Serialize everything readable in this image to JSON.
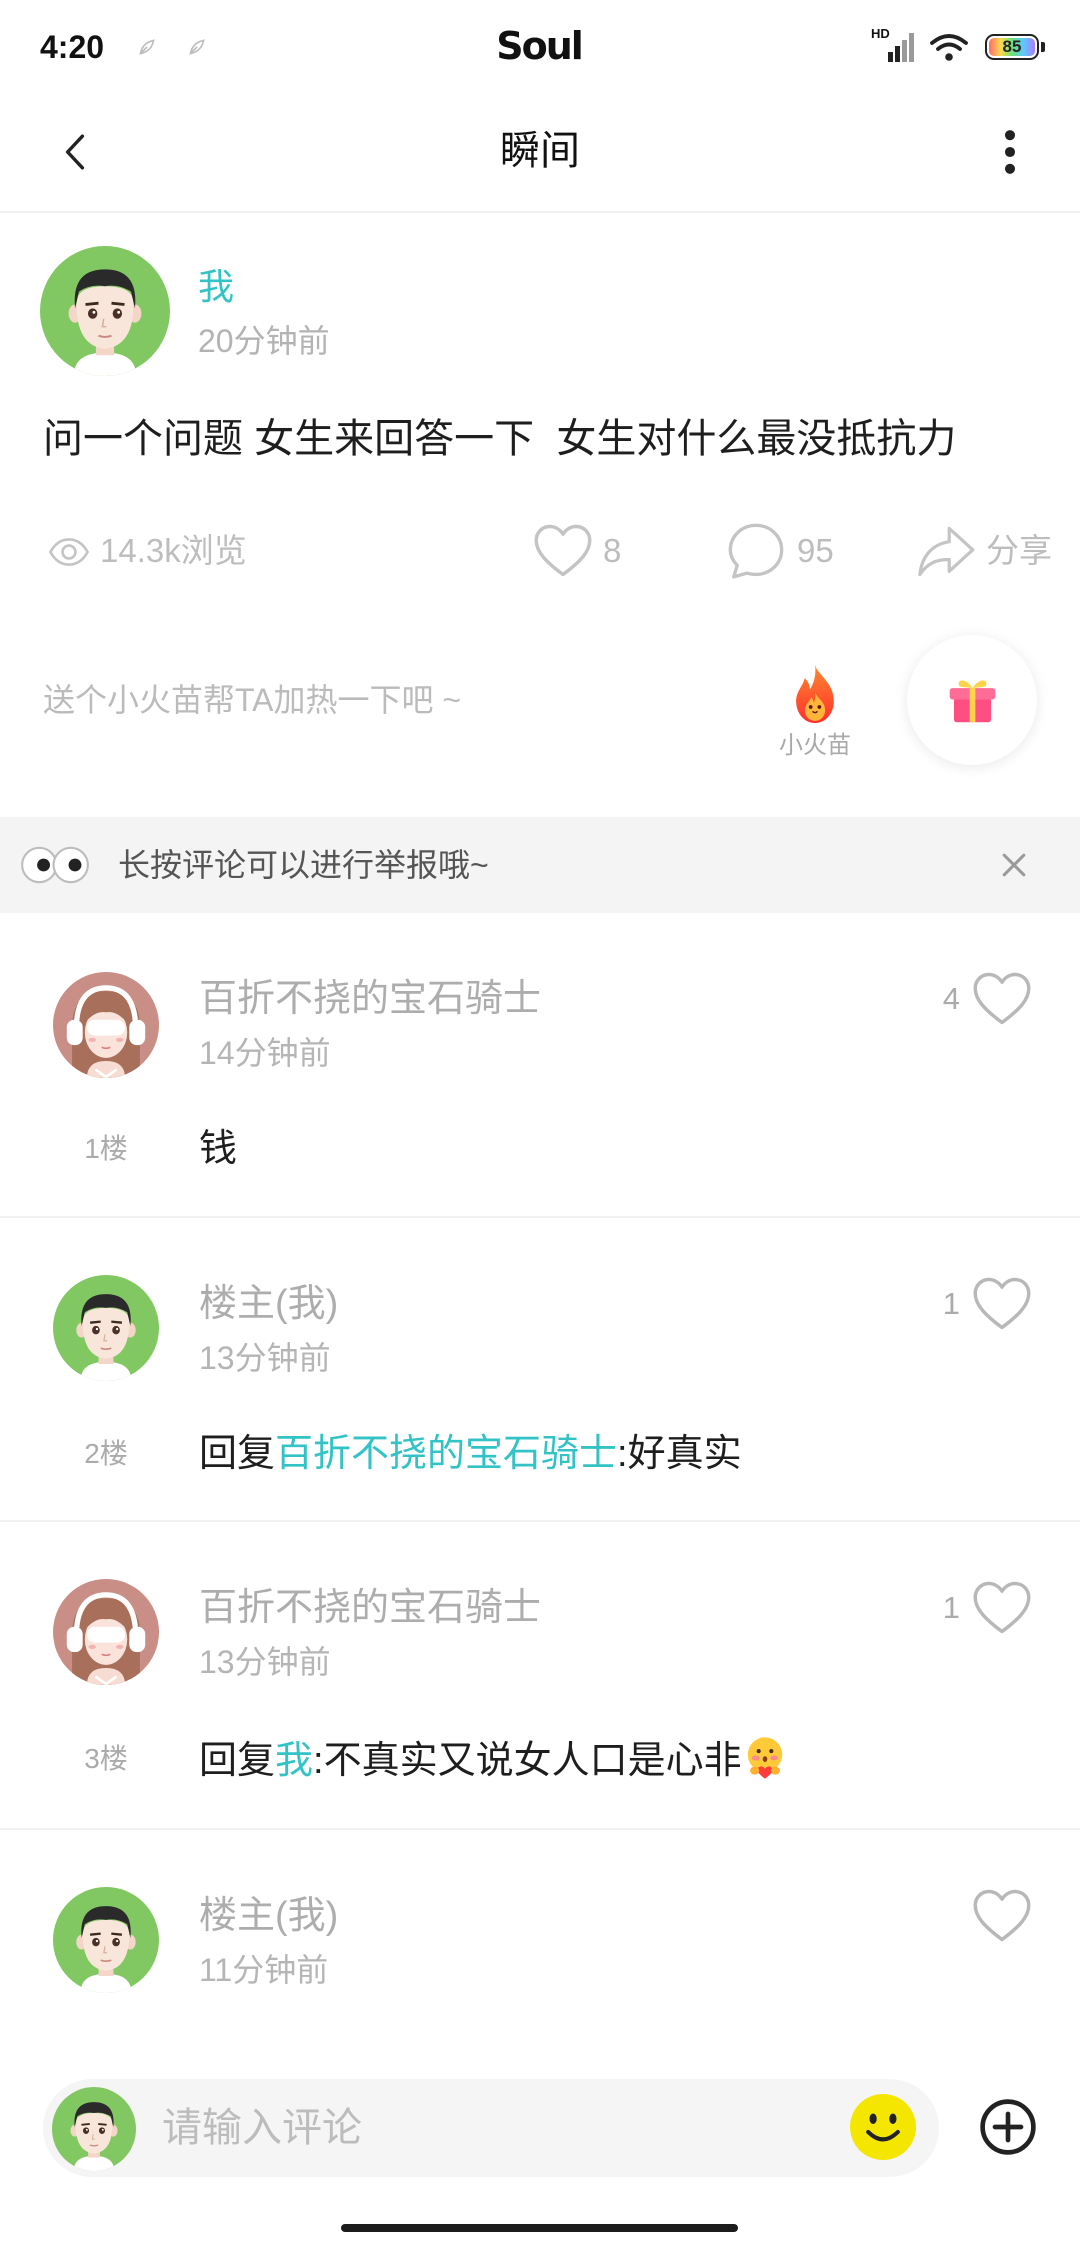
{
  "status_bar": {
    "time": "4:20",
    "app_name": "Soul",
    "network_label": "HD",
    "battery": "85"
  },
  "header": {
    "title": "瞬间",
    "back_icon": "chevron-left-icon",
    "more_icon": "more-vertical-icon"
  },
  "post": {
    "author": "我",
    "time": "20分钟前",
    "text": "问一个问题 女生来回答一下  女生对什么最没抵抗力",
    "views": "14.3k浏览",
    "likes": "8",
    "comments": "95",
    "share_label": "分享",
    "boost_prompt": "送个小火苗帮TA加热一下吧 ~",
    "fire_label": "小火苗"
  },
  "notice": {
    "text": "长按评论可以进行举报哦~"
  },
  "comments": [
    {
      "floor": "1楼",
      "name": "百折不挠的宝石骑士",
      "time": "14分钟前",
      "likes": "4",
      "reply_prefix": "",
      "mention": "",
      "text": "钱"
    },
    {
      "floor": "2楼",
      "name": "楼主(我)",
      "time": "13分钟前",
      "likes": "1",
      "reply_prefix": "回复",
      "mention": "百折不挠的宝石骑士",
      "text": ":好真实"
    },
    {
      "floor": "3楼",
      "name": "百折不挠的宝石骑士",
      "time": "13分钟前",
      "likes": "1",
      "reply_prefix": "回复",
      "mention": "我",
      "text": ":不真实又说女人口是心非",
      "emoji": "shy-emoji-icon"
    },
    {
      "name": "楼主(我)",
      "time": "11分钟前",
      "likes": ""
    }
  ],
  "composer": {
    "placeholder": "请输入评论"
  },
  "colors": {
    "accent": "#33c3c6",
    "muted_text": "#adadad",
    "body_text": "#1e1e1e",
    "notice_bg": "#f4f4f4",
    "emoji_button": "#f5e600",
    "gift": "#ff4f82",
    "fire": "#ff4a2e"
  }
}
